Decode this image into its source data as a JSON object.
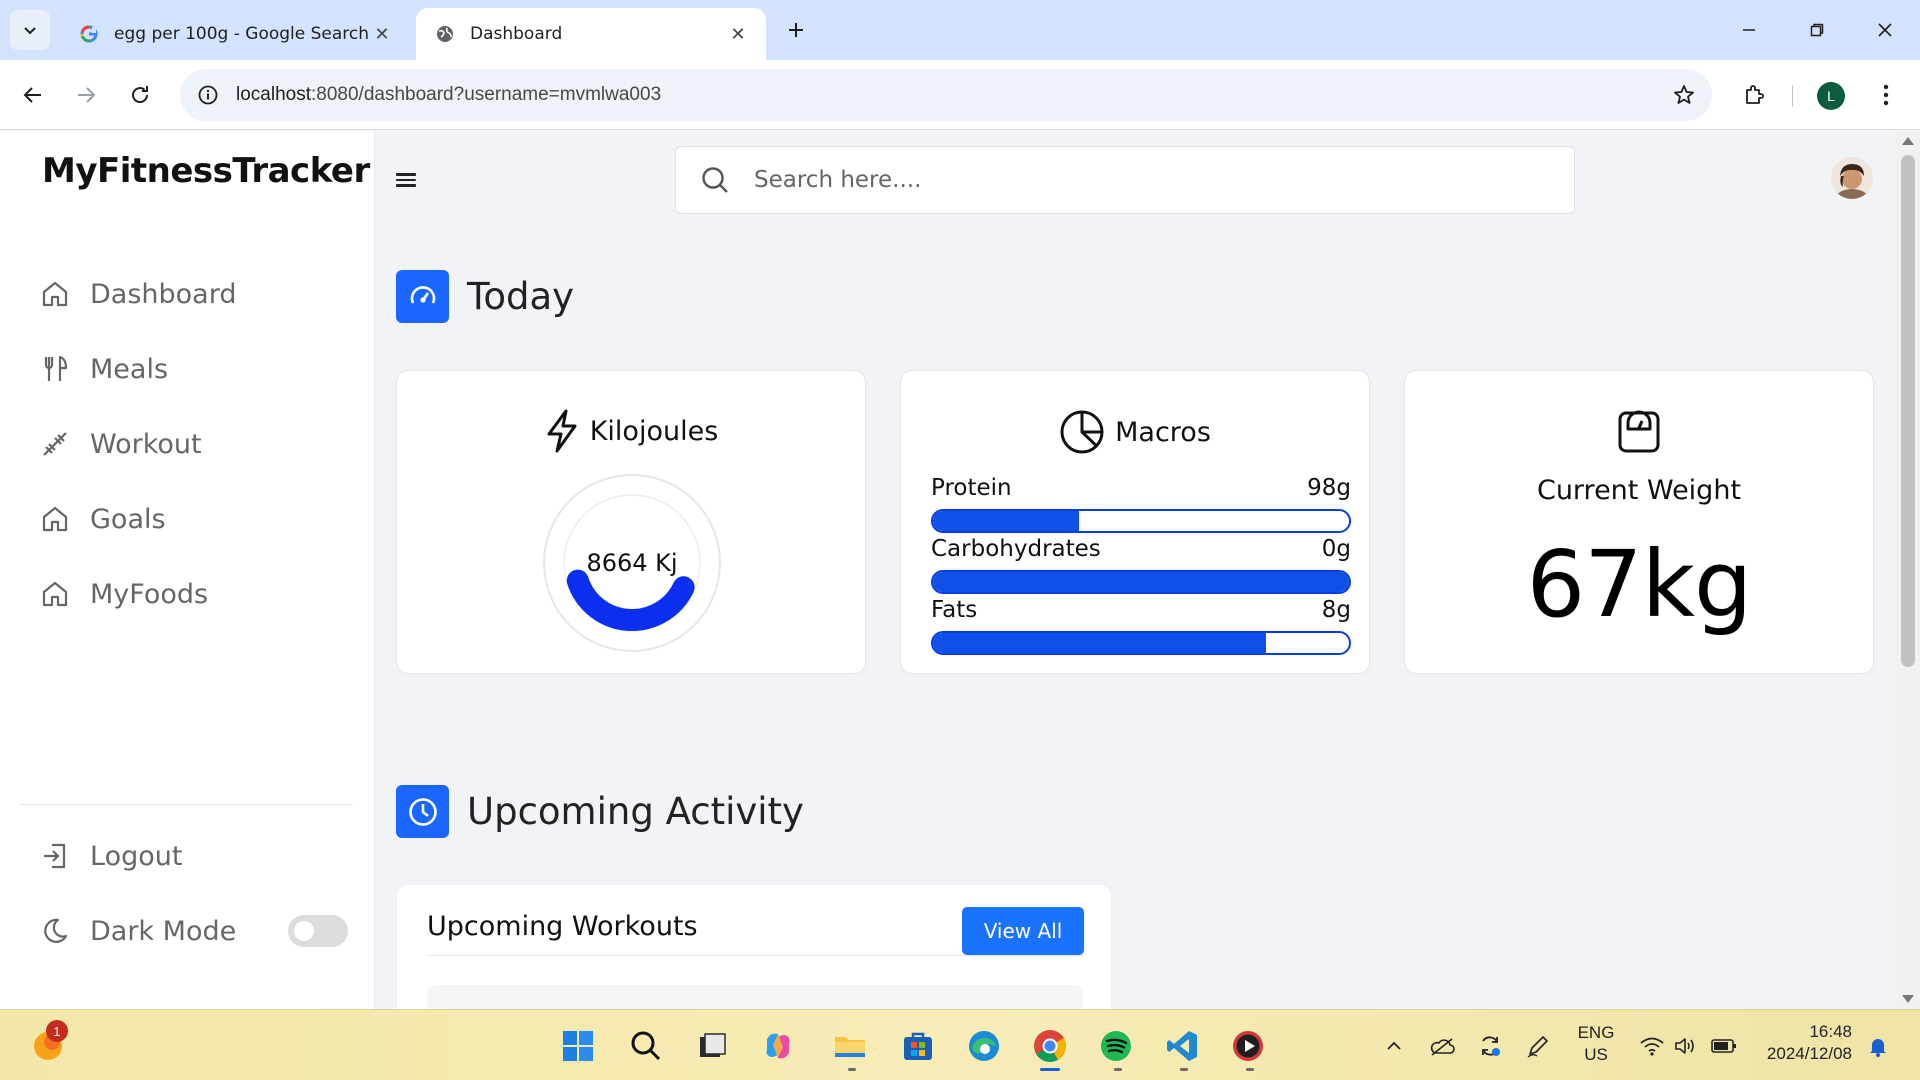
{
  "browser": {
    "tabs": [
      {
        "title": "egg per 100g - Google Search",
        "active": false,
        "favicon": "google-icon"
      },
      {
        "title": "Dashboard",
        "active": true,
        "favicon": "globe-icon"
      }
    ],
    "close_glyph": "✕",
    "url_host": "localhost",
    "url_rest": ":8080/dashboard?username=mvmlwa003",
    "profile_initial": "L"
  },
  "app": {
    "brand": "MyFitnessTracker",
    "nav": [
      {
        "label": "Dashboard",
        "icon": "home-icon"
      },
      {
        "label": "Meals",
        "icon": "utensils-icon"
      },
      {
        "label": "Workout",
        "icon": "dumbbell-icon"
      },
      {
        "label": "Goals",
        "icon": "home-icon"
      },
      {
        "label": "MyFoods",
        "icon": "home-icon"
      }
    ],
    "logout_label": "Logout",
    "dark_mode_label": "Dark Mode",
    "dark_mode_on": false,
    "search_placeholder": "Search here....",
    "accent_color": "#1a66ff"
  },
  "today": {
    "title": "Today",
    "kilojoules": {
      "title": "Kilojoules",
      "value_label": "8664 Kj",
      "progress_fraction": 0.38
    },
    "macros": {
      "title": "Macros",
      "items": [
        {
          "label": "Protein",
          "value": "98g",
          "fill_fraction": 0.35
        },
        {
          "label": "Carbohydrates",
          "value": "0g",
          "fill_fraction": 1.0
        },
        {
          "label": "Fats",
          "value": "8g",
          "fill_fraction": 0.8
        }
      ]
    },
    "weight": {
      "title": "Current Weight",
      "value": "67kg"
    }
  },
  "upcoming": {
    "title": "Upcoming Activity",
    "workouts_title": "Upcoming Workouts",
    "view_all_label": "View All"
  },
  "taskbar": {
    "notification_count": "1",
    "lang_line1": "ENG",
    "lang_line2": "US",
    "time": "16:48",
    "date": "2024/12/08"
  }
}
